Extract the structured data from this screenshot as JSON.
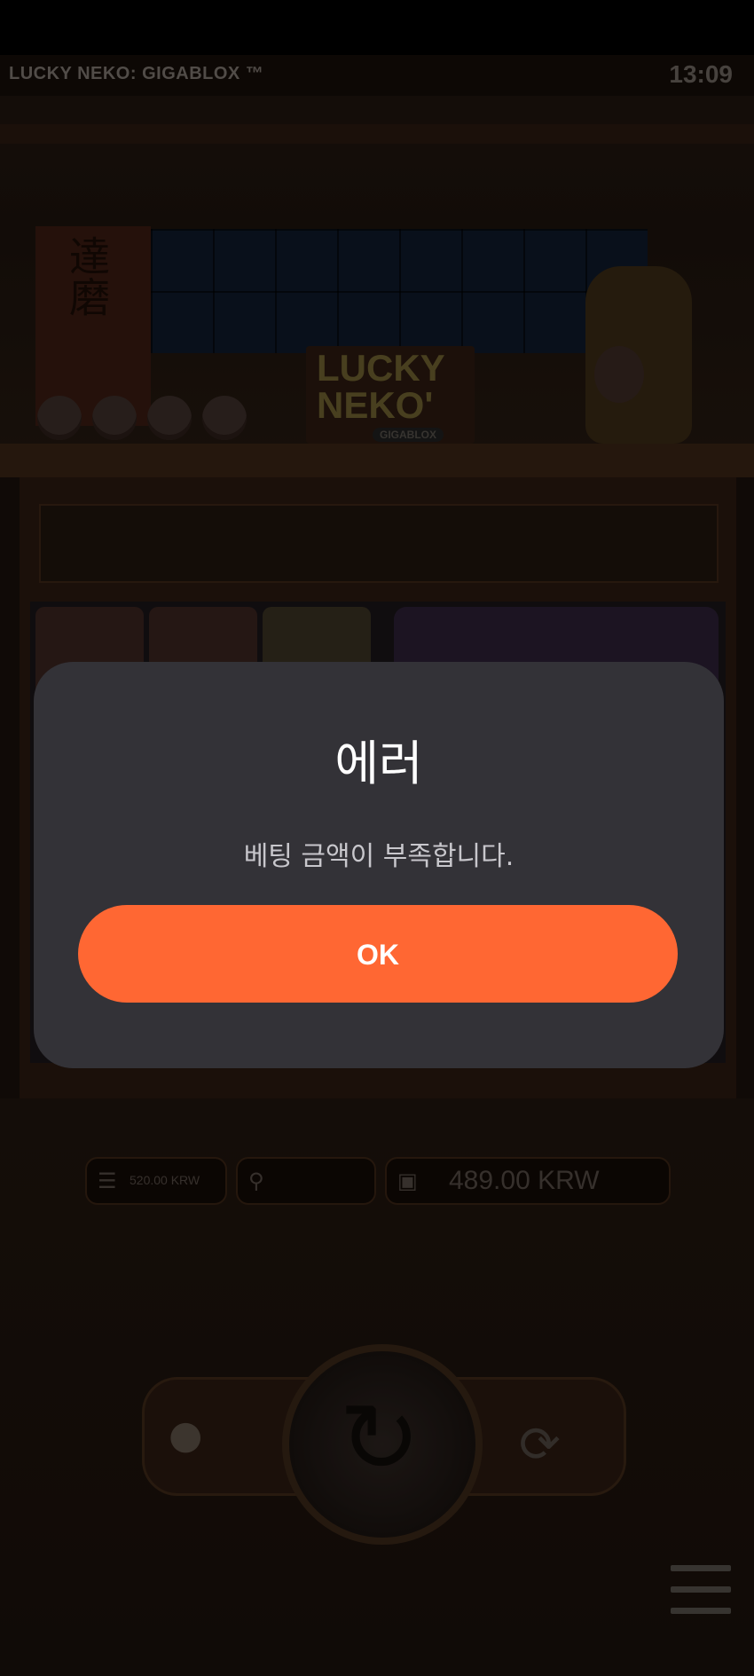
{
  "game": {
    "title": "LUCKY NEKO: GIGABLOX ™",
    "clock": "13:09",
    "logo": {
      "line1": "LUCKY",
      "line2": "NEKO'",
      "sub": "GIGABLOX"
    },
    "banner_glyphs": "達磨"
  },
  "hud": {
    "bet_value": "520.00 KRW",
    "win_value": "",
    "balance_value": "489.00 KRW"
  },
  "dialog": {
    "title": "에러",
    "message": "베팅 금액이 부족합니다.",
    "ok_label": "OK"
  },
  "colors": {
    "dialog_bg": "#333237",
    "accent": "#ff6733",
    "title_text": "#ffffff"
  },
  "icons": [
    "coins-icon",
    "trophy-icon",
    "wallet-icon",
    "spin-arrow-icon",
    "autoplay-icon",
    "menu-icon"
  ]
}
